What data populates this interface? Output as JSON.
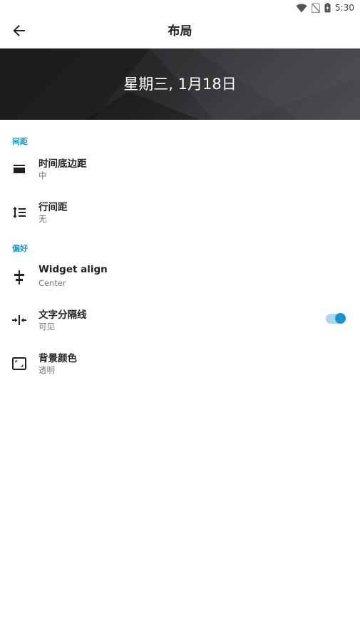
{
  "status_bar": {
    "time": "5:30"
  },
  "app_bar": {
    "title": "布局"
  },
  "banner": {
    "date_text": "星期三, 1月18日"
  },
  "sections": {
    "spacing": {
      "header": "间距",
      "items": [
        {
          "title": "时间底边距",
          "subtitle": "中",
          "icon": "bottom-padding-icon"
        },
        {
          "title": "行间距",
          "subtitle": "无",
          "icon": "line-spacing-icon"
        }
      ]
    },
    "preferences": {
      "header": "偏好",
      "items": [
        {
          "title": "Widget align",
          "subtitle": "Center",
          "icon": "align-icon"
        },
        {
          "title": "文字分隔线",
          "subtitle": "可见",
          "icon": "divider-icon",
          "toggle_on": true
        },
        {
          "title": "背景颜色",
          "subtitle": "透明",
          "icon": "background-icon"
        }
      ]
    }
  },
  "colors": {
    "accent": "#1595c9",
    "accent_track": "#a9d7ee"
  }
}
